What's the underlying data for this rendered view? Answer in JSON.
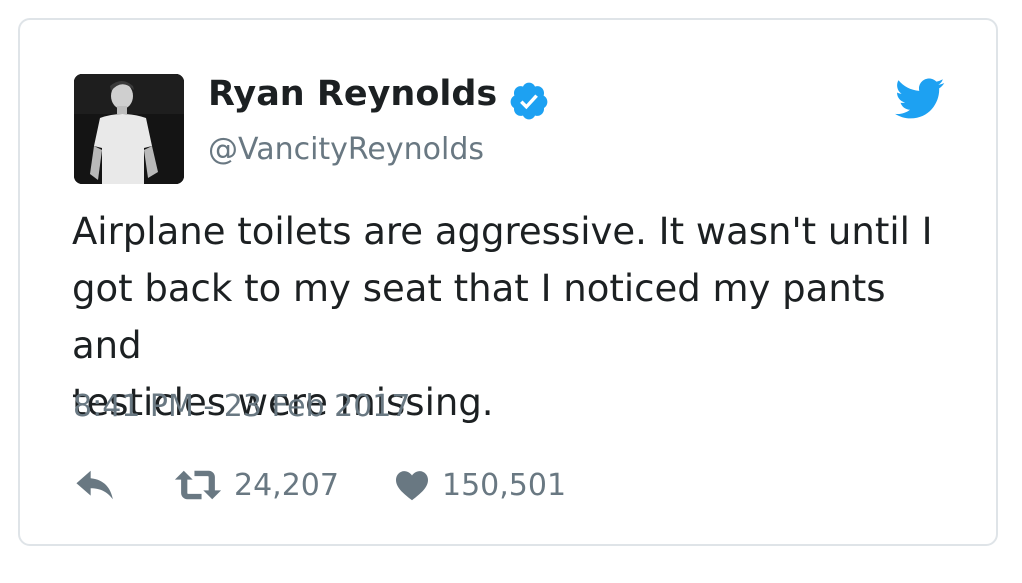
{
  "tweet": {
    "author_name": "Ryan Reynolds",
    "author_handle": "@VancityReynolds",
    "verified": true,
    "text": "Airplane toilets are aggressive. It wasn't until I\ngot back to my seat that I noticed my pants and\ntesticles were missing.",
    "timestamp": "8:41 PM - 23 Feb 2017",
    "retweet_count": "24,207",
    "like_count": "150,501"
  },
  "icons": {
    "verified": "verified-badge-icon",
    "brand": "twitter-bird-icon",
    "reply": "reply-icon",
    "retweet": "retweet-icon",
    "like": "heart-icon"
  },
  "colors": {
    "twitter_blue": "#1da1f2",
    "text": "#1c2022",
    "secondary_text": "#697882",
    "border": "#dfe4e8"
  }
}
